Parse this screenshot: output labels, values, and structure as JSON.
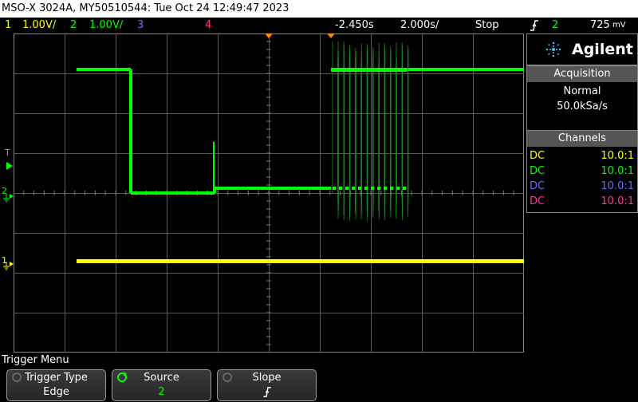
{
  "title": "MSO-X 3024A, MY50510544: Tue Oct 24 12:49:47 2023",
  "status": {
    "ch1_num": "1",
    "ch1_scale": "1.00V/",
    "ch2_num": "2",
    "ch2_scale": "1.00V/",
    "ch3_num": "3",
    "ch4_num": "4",
    "delay": "-2.450s",
    "timebase": "2.000s/",
    "run_state": "Stop",
    "trigger_slope_icon": "rising-edge-icon",
    "trigger_source": "2",
    "trigger_level": "725",
    "trigger_level_unit": "mV"
  },
  "markers": {
    "trigger": "T",
    "ch2": "2",
    "ch1": "1"
  },
  "brand": "Agilent",
  "acquisition": {
    "header": "Acquisition",
    "mode": "Normal",
    "rate": "50.0kSa/s"
  },
  "channels": {
    "header": "Channels",
    "rows": [
      {
        "coupling": "DC",
        "probe": "10.0:1",
        "color": "#ffff00"
      },
      {
        "coupling": "DC",
        "probe": "10.0:1",
        "color": "#00ff00"
      },
      {
        "coupling": "DC",
        "probe": "10.0:1",
        "color": "#6a6aff"
      },
      {
        "coupling": "DC",
        "probe": "10.0:1",
        "color": "#ff3399"
      }
    ]
  },
  "menu": {
    "title": "Trigger Menu",
    "softkeys": [
      {
        "label": "Trigger Type",
        "value": "Edge"
      },
      {
        "label": "Source",
        "value": "2"
      },
      {
        "label": "Slope",
        "value": "rising-edge-icon"
      }
    ]
  },
  "colors": {
    "ch1": "#ffff00",
    "ch2": "#00ff00",
    "ch3": "#6a6aff",
    "ch4": "#ff3399",
    "trigger": "#ff8c00",
    "grid": "#5a5a5a"
  }
}
